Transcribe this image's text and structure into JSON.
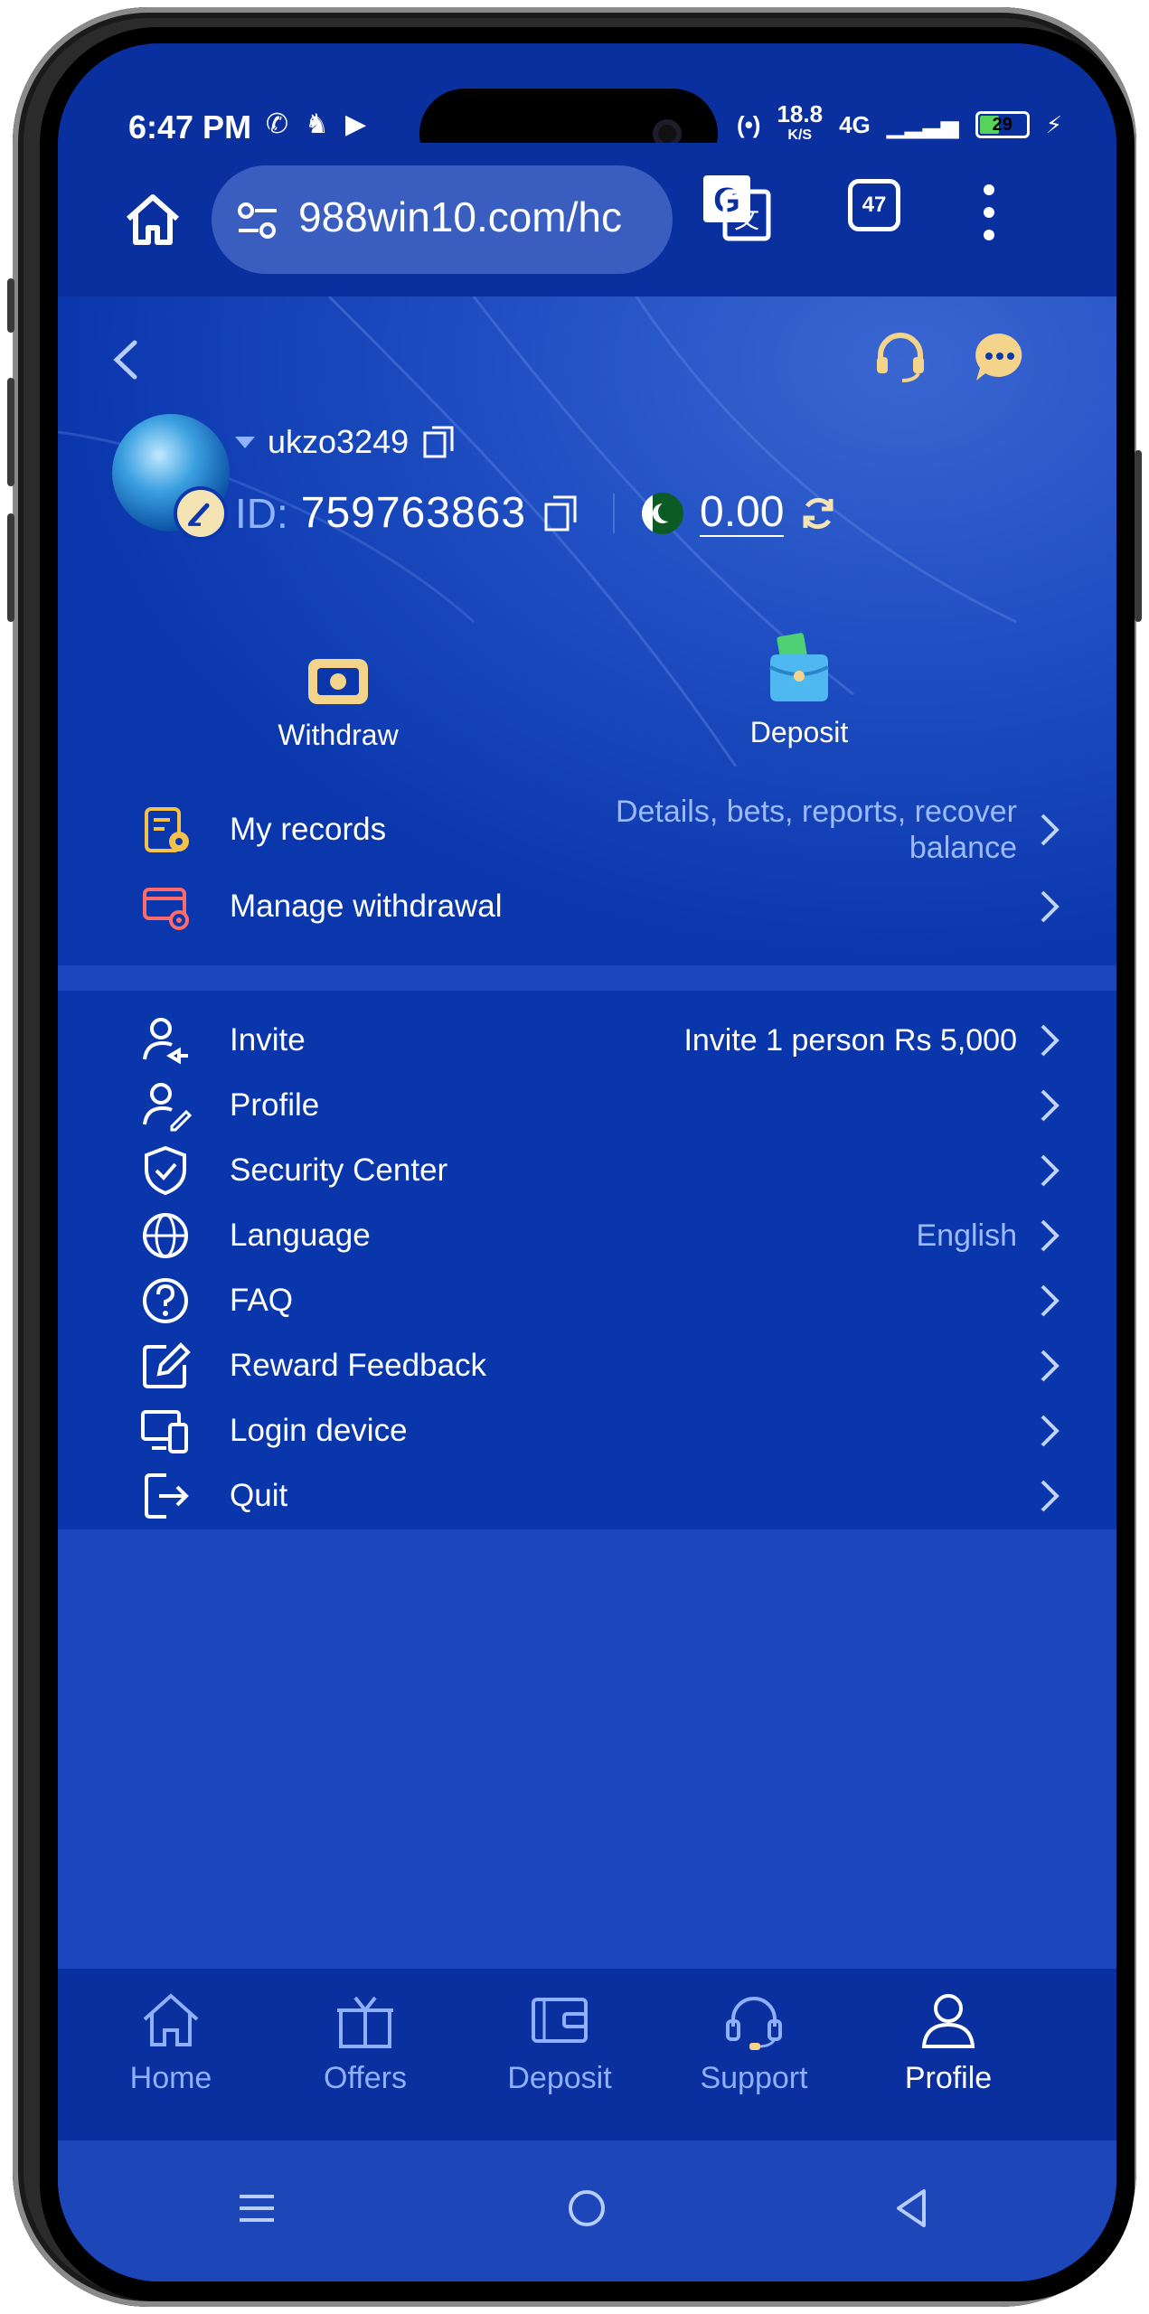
{
  "status_bar": {
    "time": "6:47 PM",
    "net_speed": "18.8",
    "net_unit": "K/S",
    "network": "4G",
    "battery": "29"
  },
  "browser": {
    "url": "988win10.com/hc",
    "tab_count": "47"
  },
  "account": {
    "username": "ukzo3249",
    "id_label": "ID:",
    "id_value": "759763863",
    "balance": "0.00"
  },
  "actions": {
    "withdraw": "Withdraw",
    "deposit": "Deposit"
  },
  "records": [
    {
      "label": "My records",
      "value": "Details, bets, reports, recover balance",
      "icon": "records-icon"
    },
    {
      "label": "Manage withdrawal",
      "value": "",
      "icon": "card-gear-icon"
    }
  ],
  "menu": [
    {
      "label": "Invite",
      "value": "Invite 1 person Rs 5,000",
      "icon": "invite-user-icon"
    },
    {
      "label": "Profile",
      "value": "",
      "icon": "user-edit-icon"
    },
    {
      "label": "Security Center",
      "value": "",
      "icon": "shield-check-icon"
    },
    {
      "label": "Language",
      "value": "English",
      "icon": "globe-icon"
    },
    {
      "label": "FAQ",
      "value": "",
      "icon": "question-icon"
    },
    {
      "label": "Reward Feedback",
      "value": "",
      "icon": "edit-square-icon"
    },
    {
      "label": "Login device",
      "value": "",
      "icon": "devices-icon"
    },
    {
      "label": "Quit",
      "value": "",
      "icon": "logout-icon"
    }
  ],
  "bottom_nav": [
    {
      "label": "Home",
      "icon": "home-icon",
      "active": false
    },
    {
      "label": "Offers",
      "icon": "gift-icon",
      "active": false
    },
    {
      "label": "Deposit",
      "icon": "wallet-icon",
      "active": false
    },
    {
      "label": "Support",
      "icon": "headset-icon",
      "active": false
    },
    {
      "label": "Profile",
      "icon": "user-icon",
      "active": true
    }
  ],
  "colors": {
    "background": "#0a35ad",
    "accent_text": "#9db9ff",
    "icon_gold": "#f4d48a",
    "icon_red": "#ff6b6b"
  }
}
